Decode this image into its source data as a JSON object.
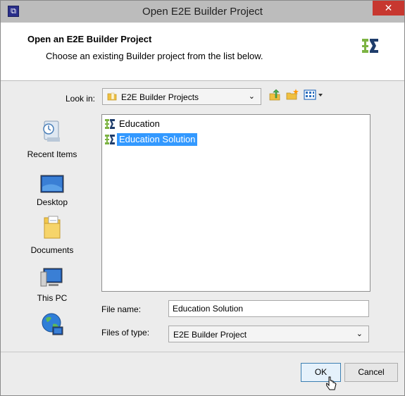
{
  "window": {
    "title": "Open E2E Builder Project",
    "close_glyph": "✕"
  },
  "header": {
    "title": "Open an E2E Builder Project",
    "subtitle": "Choose an existing Builder project from the list below.",
    "logo_icon": "e2e-logo-icon"
  },
  "look_in": {
    "label": "Look in:",
    "value": "E2E Builder Projects",
    "arrow": "⌄"
  },
  "places": [
    {
      "label": "Recent Items",
      "icon": "recent-items-icon"
    },
    {
      "label": "Desktop",
      "icon": "desktop-icon"
    },
    {
      "label": "Documents",
      "icon": "documents-icon"
    },
    {
      "label": "This PC",
      "icon": "this-pc-icon"
    },
    {
      "label": "",
      "icon": "network-icon"
    }
  ],
  "files": [
    {
      "name": "Education",
      "selected": false
    },
    {
      "name": "Education Solution",
      "selected": true
    }
  ],
  "file_name": {
    "label": "File name:",
    "value": "Education Solution"
  },
  "file_type": {
    "label": "Files of type:",
    "value": "E2E Builder Project",
    "arrow": "⌄"
  },
  "buttons": {
    "ok": "OK",
    "cancel": "Cancel"
  },
  "colors": {
    "selection": "#3399ff",
    "close": "#c7372f",
    "logo_green": "#7cb342",
    "logo_dark": "#1f3d6b"
  }
}
